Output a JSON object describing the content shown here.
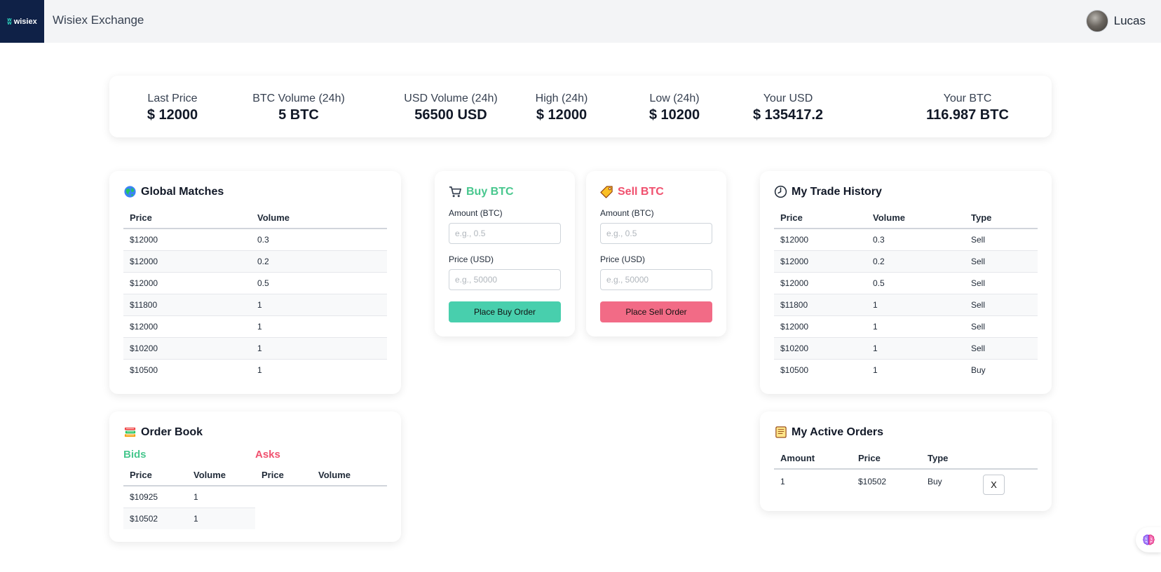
{
  "header": {
    "logo_text": "wisiex",
    "brand_title": "Wisiex Exchange",
    "user_name": "Lucas"
  },
  "stats": [
    {
      "label": "Last Price",
      "value": "$ 12000"
    },
    {
      "label": "BTC Volume (24h)",
      "value": "5 BTC"
    },
    {
      "label": "USD Volume (24h)",
      "value": "56500 USD"
    },
    {
      "label": "High (24h)",
      "value": "$ 12000"
    },
    {
      "label": "Low (24h)",
      "value": "$ 10200"
    },
    {
      "label": "Your USD",
      "value": "$ 135417.2"
    },
    {
      "label": "Your BTC",
      "value": "116.987 BTC"
    }
  ],
  "global_matches": {
    "title": "Global Matches",
    "icon": "globe-icon",
    "columns": [
      "Price",
      "Volume"
    ],
    "rows": [
      [
        "$12000",
        "0.3"
      ],
      [
        "$12000",
        "0.2"
      ],
      [
        "$12000",
        "0.5"
      ],
      [
        "$11800",
        "1"
      ],
      [
        "$12000",
        "1"
      ],
      [
        "$10200",
        "1"
      ],
      [
        "$10500",
        "1"
      ]
    ]
  },
  "buy": {
    "title": "Buy BTC",
    "icon": "cart-icon",
    "amount_label": "Amount (BTC)",
    "amount_placeholder": "e.g., 0.5",
    "price_label": "Price (USD)",
    "price_placeholder": "e.g., 50000",
    "button_label": "Place Buy Order",
    "color": "#48cfad"
  },
  "sell": {
    "title": "Sell BTC",
    "icon": "tag-icon",
    "amount_label": "Amount (BTC)",
    "amount_placeholder": "e.g., 0.5",
    "price_label": "Price (USD)",
    "price_placeholder": "e.g., 50000",
    "button_label": "Place Sell Order",
    "color": "#f26b86"
  },
  "trade_history": {
    "title": "My Trade History",
    "icon": "clock-icon",
    "columns": [
      "Price",
      "Volume",
      "Type"
    ],
    "rows": [
      [
        "$12000",
        "0.3",
        "Sell"
      ],
      [
        "$12000",
        "0.2",
        "Sell"
      ],
      [
        "$12000",
        "0.5",
        "Sell"
      ],
      [
        "$11800",
        "1",
        "Sell"
      ],
      [
        "$12000",
        "1",
        "Sell"
      ],
      [
        "$10200",
        "1",
        "Sell"
      ],
      [
        "$10500",
        "1",
        "Buy"
      ]
    ]
  },
  "order_book": {
    "title": "Order Book",
    "icon": "books-icon",
    "bids_label": "Bids",
    "asks_label": "Asks",
    "columns": [
      "Price",
      "Volume",
      "Price",
      "Volume"
    ],
    "bids": [
      [
        "$10925",
        "1"
      ],
      [
        "$10502",
        "1"
      ]
    ],
    "asks": []
  },
  "active_orders": {
    "title": "My Active Orders",
    "icon": "scroll-icon",
    "columns": [
      "Amount",
      "Price",
      "Type"
    ],
    "rows": [
      {
        "amount": "1",
        "price": "$10502",
        "type": "Buy",
        "cancel_label": "X"
      }
    ]
  },
  "floating_widget": {
    "icon": "brain-icon"
  }
}
